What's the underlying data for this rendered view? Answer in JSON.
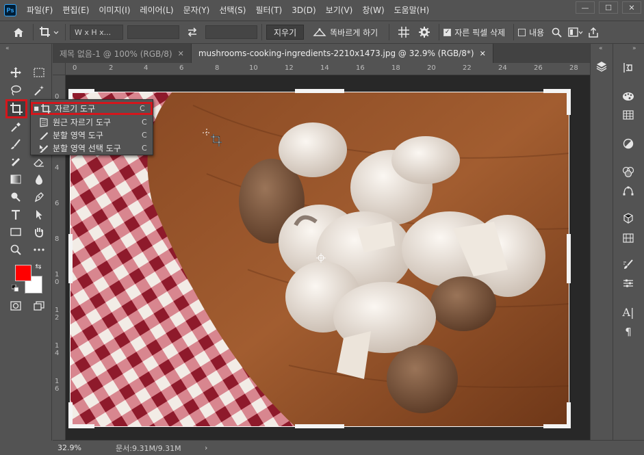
{
  "app": {
    "logo": "Ps"
  },
  "menu": [
    "파일(F)",
    "편집(E)",
    "이미지(I)",
    "레이어(L)",
    "문자(Y)",
    "선택(S)",
    "필터(T)",
    "3D(D)",
    "보기(V)",
    "창(W)",
    "도움말(H)"
  ],
  "window_controls": [
    "—",
    "☐",
    "✕"
  ],
  "options": {
    "ratio": "W x H x...",
    "clear_label": "지우기",
    "straighten_label": "똑바르게 하기",
    "delete_pixels_label": "자른 픽셀 삭제",
    "delete_pixels_checked": true,
    "content_label": "내용",
    "content_checked": false
  },
  "tabs": [
    {
      "label": "제목 없음-1 @ 100% (RGB/8)",
      "active": false
    },
    {
      "label": "mushrooms-cooking-ingredients-2210x1473.jpg @ 32.9% (RGB/8*)",
      "active": true
    }
  ],
  "ruler_h": [
    "0",
    "2",
    "4",
    "6",
    "8",
    "10",
    "12",
    "14",
    "16",
    "18",
    "20",
    "22",
    "24",
    "26",
    "28"
  ],
  "ruler_v": [
    "0",
    "2",
    "4",
    "6",
    "8",
    "1 0",
    "1 2",
    "1 4",
    "1 6"
  ],
  "flyout": [
    {
      "label": "자르기 도구",
      "key": "C",
      "selected": true,
      "icon": "crop-icon"
    },
    {
      "label": "원근 자르기 도구",
      "key": "C",
      "selected": false,
      "icon": "perspective-crop-icon"
    },
    {
      "label": "분할 영역 도구",
      "key": "C",
      "selected": false,
      "icon": "slice-icon"
    },
    {
      "label": "분할 영역 선택 도구",
      "key": "C",
      "selected": false,
      "icon": "slice-select-icon"
    }
  ],
  "colors": {
    "foreground": "#ff0000",
    "background": "#ffffff",
    "accent_highlight": "#d4161c"
  },
  "status": {
    "zoom": "32.9%",
    "doc": "문서:9.31M/9.31M"
  }
}
